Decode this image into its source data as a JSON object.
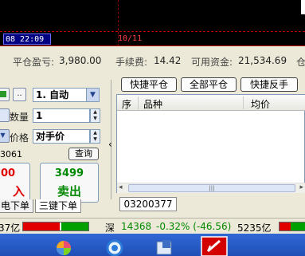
{
  "chart": {
    "time_left": "08 22:09",
    "time_right": "10/11"
  },
  "account": {
    "pnl_label": "平仓盈亏:",
    "pnl_value": "3,980.00",
    "fee_label": "手续费:",
    "fee_value": "14.42",
    "funds_label": "可用资金:",
    "funds_value": "21,534.69",
    "overflow_char": "仓"
  },
  "order_form": {
    "left_btn_icon": "green-square-icon",
    "dots_btn": "..",
    "mode_select": "1. 自动",
    "qty_label": "数量",
    "qty_value": "1",
    "price_label": "价格",
    "price_value": "对手价",
    "code_fragment": "3061",
    "query_btn": "查询",
    "buy_price": "00",
    "buy_action": "入",
    "sell_price": "3499",
    "sell_action": "卖出",
    "collapse_arrow": "‹"
  },
  "tabs": [
    "电下单",
    "三键下单"
  ],
  "positions": {
    "buttons": [
      "快捷平仓",
      "全部平仓",
      "快捷反手"
    ],
    "columns": [
      "序",
      "品种",
      "均价"
    ],
    "code_tab": "03200377"
  },
  "status_bar": {
    "left_fragment": "37亿",
    "sz_label": "深",
    "sz_value": "14368",
    "sz_change": "-0.32% (-46.56)",
    "sz_volume": "5235亿"
  },
  "colors": {
    "up": "#e00000",
    "down": "#008800",
    "accent": "#000080"
  }
}
